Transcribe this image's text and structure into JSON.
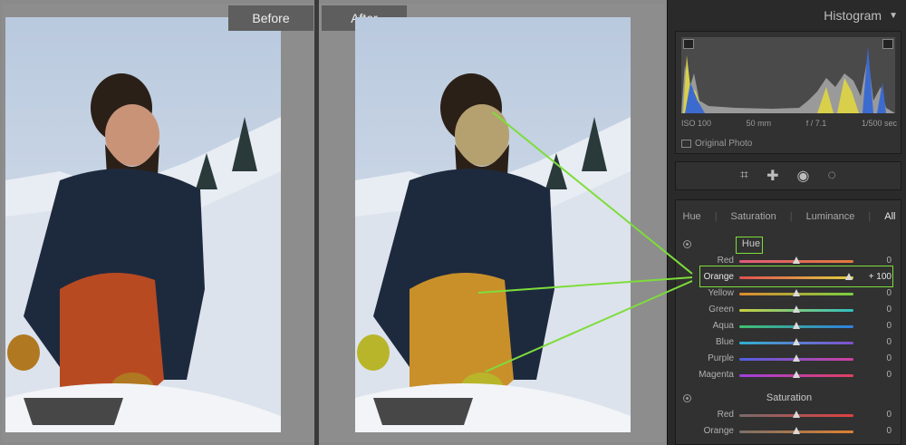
{
  "compare": {
    "before_label": "Before",
    "after_label": "After"
  },
  "histogram": {
    "title": "Histogram",
    "iso": "ISO 100",
    "focal": "50 mm",
    "aperture": "f / 7.1",
    "shutter": "1/500 sec",
    "original_photo_label": "Original Photo"
  },
  "tools": [
    {
      "icon": "crop-icon",
      "glyph": "⌗"
    },
    {
      "icon": "healing-icon",
      "glyph": "✚"
    },
    {
      "icon": "redeye-icon",
      "glyph": "◉"
    },
    {
      "icon": "masking-icon",
      "glyph": "◌"
    }
  ],
  "hsl": {
    "tabs": [
      "Hue",
      "Saturation",
      "Luminance",
      "All"
    ],
    "active_tab": "All",
    "hue_title": "Hue",
    "saturation_title": "Saturation",
    "hue_rows": [
      {
        "label": "Red",
        "value": "0",
        "pos": 0.5,
        "colors": [
          "#e05a7a",
          "#e07a3a"
        ]
      },
      {
        "label": "Orange",
        "value": "+ 100",
        "pos": 0.96,
        "colors": [
          "#e05050",
          "#e0d040"
        ]
      },
      {
        "label": "Yellow",
        "value": "0",
        "pos": 0.5,
        "colors": [
          "#e08a30",
          "#7ad040"
        ]
      },
      {
        "label": "Green",
        "value": "0",
        "pos": 0.5,
        "colors": [
          "#c8d040",
          "#30c0c0"
        ]
      },
      {
        "label": "Aqua",
        "value": "0",
        "pos": 0.5,
        "colors": [
          "#40c070",
          "#3080e0"
        ]
      },
      {
        "label": "Blue",
        "value": "0",
        "pos": 0.5,
        "colors": [
          "#30b0d0",
          "#8050d0"
        ]
      },
      {
        "label": "Purple",
        "value": "0",
        "pos": 0.5,
        "colors": [
          "#5060e0",
          "#d040a0"
        ]
      },
      {
        "label": "Magenta",
        "value": "0",
        "pos": 0.5,
        "colors": [
          "#a040e0",
          "#e04060"
        ]
      }
    ],
    "sat_rows": [
      {
        "label": "Red",
        "value": "0",
        "pos": 0.5,
        "colors": [
          "#7a6a6a",
          "#e04040"
        ]
      },
      {
        "label": "Orange",
        "value": "0",
        "pos": 0.5,
        "colors": [
          "#7a706a",
          "#e08030"
        ]
      }
    ]
  },
  "colors": {
    "annotation": "#7ddd3a"
  }
}
